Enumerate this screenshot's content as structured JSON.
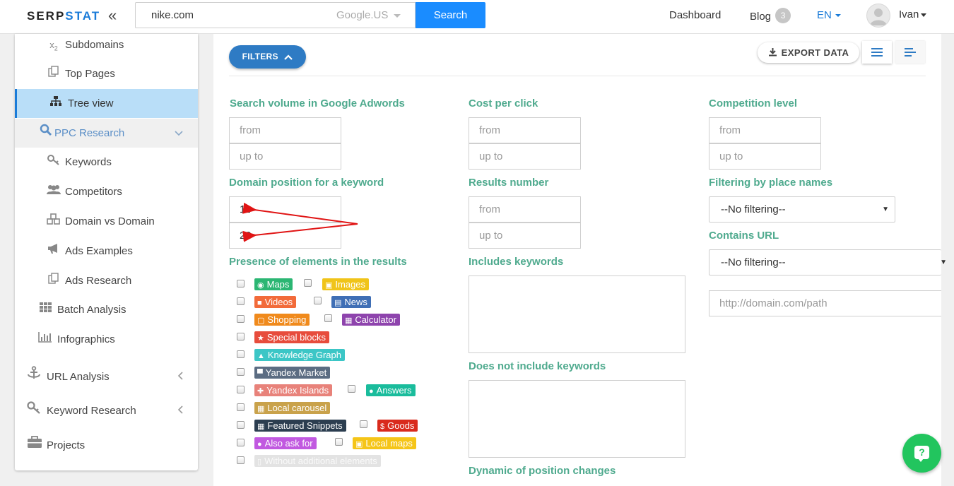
{
  "brand": {
    "logo_part1": "SERP",
    "logo_part2": "STAT",
    "accent_color": "#1a7bd8"
  },
  "header": {
    "search_value": "nike.com",
    "engine": "Google.US",
    "search_label": "Search",
    "nav_dashboard": "Dashboard",
    "nav_blog": "Blog",
    "blog_count": "3",
    "language": "EN",
    "user": "Ivan"
  },
  "sidebar": {
    "items": [
      {
        "label": "Subdomains",
        "icon": "subscript-icon"
      },
      {
        "label": "Top Pages",
        "icon": "copy-icon"
      },
      {
        "label": "Tree view",
        "icon": "sitemap-icon"
      },
      {
        "label": "PPC Research",
        "icon": "search-icon"
      },
      {
        "label": "Keywords",
        "icon": "key-icon"
      },
      {
        "label": "Competitors",
        "icon": "users-icon"
      },
      {
        "label": "Domain vs Domain",
        "icon": "cubes-icon"
      },
      {
        "label": "Ads Examples",
        "icon": "megaphone-icon"
      },
      {
        "label": "Ads Research",
        "icon": "copy-icon"
      },
      {
        "label": "Batch Analysis",
        "icon": "grid-icon"
      },
      {
        "label": "Infographics",
        "icon": "bar-chart-icon"
      },
      {
        "label": "URL Analysis",
        "icon": "anchor-icon"
      },
      {
        "label": "Keyword Research",
        "icon": "key-icon"
      },
      {
        "label": "Projects",
        "icon": "briefcase-icon"
      }
    ]
  },
  "toolbar": {
    "filters_label": "FILTERS",
    "export_label": "EXPORT DATA"
  },
  "filters": {
    "search_volume_label": "Search volume in Google Adwords",
    "cpc_label": "Cost per click",
    "competition_label": "Competition level",
    "domain_position_label": "Domain position for a keyword",
    "results_number_label": "Results number",
    "place_names_label": "Filtering by place names",
    "contains_url_label": "Contains URL",
    "presence_label": "Presence of elements in the results",
    "includes_keywords_label": "Includes keywords",
    "not_include_keywords_label": "Does not include keywords",
    "dynamic_label": "Dynamic of position changes",
    "placeholder_from": "from",
    "placeholder_up_to": "up to",
    "position_from_value": "11",
    "position_to_value": "20",
    "place_names_value": "--No filtering--",
    "contains_url_value": "--No filtering--",
    "url_placeholder": "http://domain.com/path"
  },
  "elements": {
    "maps": "Maps",
    "images": "Images",
    "videos": "Videos",
    "news": "News",
    "shopping": "Shopping",
    "calculator": "Calculator",
    "special_blocks": "Special blocks",
    "knowledge_graph": "Knowledge Graph",
    "yandex_market": "Yandex Market",
    "yandex_islands": "Yandex Islands",
    "answers": "Answers",
    "local_carousel": "Local carousel",
    "featured_snippets": "Featured Snippets",
    "goods": "Goods",
    "also_ask_for": "Also ask for",
    "local_maps": "Local maps",
    "without_additional": "Without additional elements"
  },
  "colors": {
    "label_green": "#4faa8e",
    "maps": "#2bb673",
    "images": "#f0c419",
    "videos": "#f26b3a",
    "news": "#3f6fb5",
    "shopping": "#f08a1c",
    "calculator": "#8e44ad",
    "special_blocks": "#e74c3c",
    "knowledge_graph": "#3cc6c6",
    "yandex_market": "#5b6c82",
    "yandex_islands": "#e8827a",
    "answers": "#1abc9c",
    "local_carousel": "#c9a24b",
    "featured_snippets": "#2c3e50",
    "goods": "#d92a1c",
    "also_ask_for": "#c159e0",
    "local_maps": "#f5c518",
    "without_additional": "#e3e3e3"
  }
}
